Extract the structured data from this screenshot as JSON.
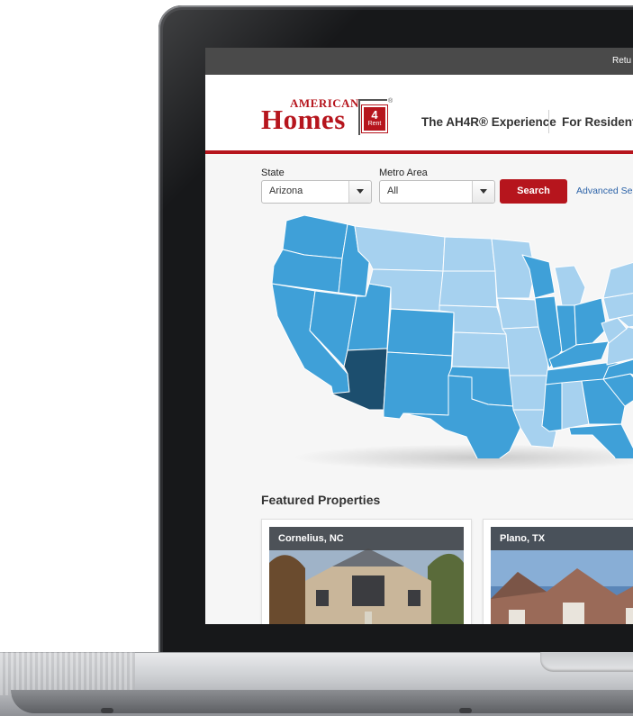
{
  "topbar": {
    "link_text": "Retu"
  },
  "logo": {
    "american": "AMERICAN",
    "homes": "Homes",
    "sign_number": "4",
    "sign_word": "Rent",
    "reg": "®"
  },
  "nav": {
    "items": [
      {
        "label": "The AH4R® Experience"
      },
      {
        "label": "For Residents"
      }
    ]
  },
  "search": {
    "state_label": "State",
    "state_value": "Arizona",
    "metro_label": "Metro Area",
    "metro_value": "All",
    "search_button": "Search",
    "advanced_link": "Advanced Se"
  },
  "map": {
    "selected_state": "Arizona",
    "colors": {
      "selected": "#1c4e6e",
      "active": "#3fa0d8",
      "inactive": "#a6d1ef",
      "border": "#ffffff"
    }
  },
  "featured": {
    "title": "Featured Properties",
    "properties": [
      {
        "location": "Cornelius, NC"
      },
      {
        "location": "Plano, TX"
      }
    ]
  },
  "colors": {
    "brand_red": "#b6151d",
    "link_blue": "#2c63a8",
    "topbar": "#4a4a4a"
  }
}
